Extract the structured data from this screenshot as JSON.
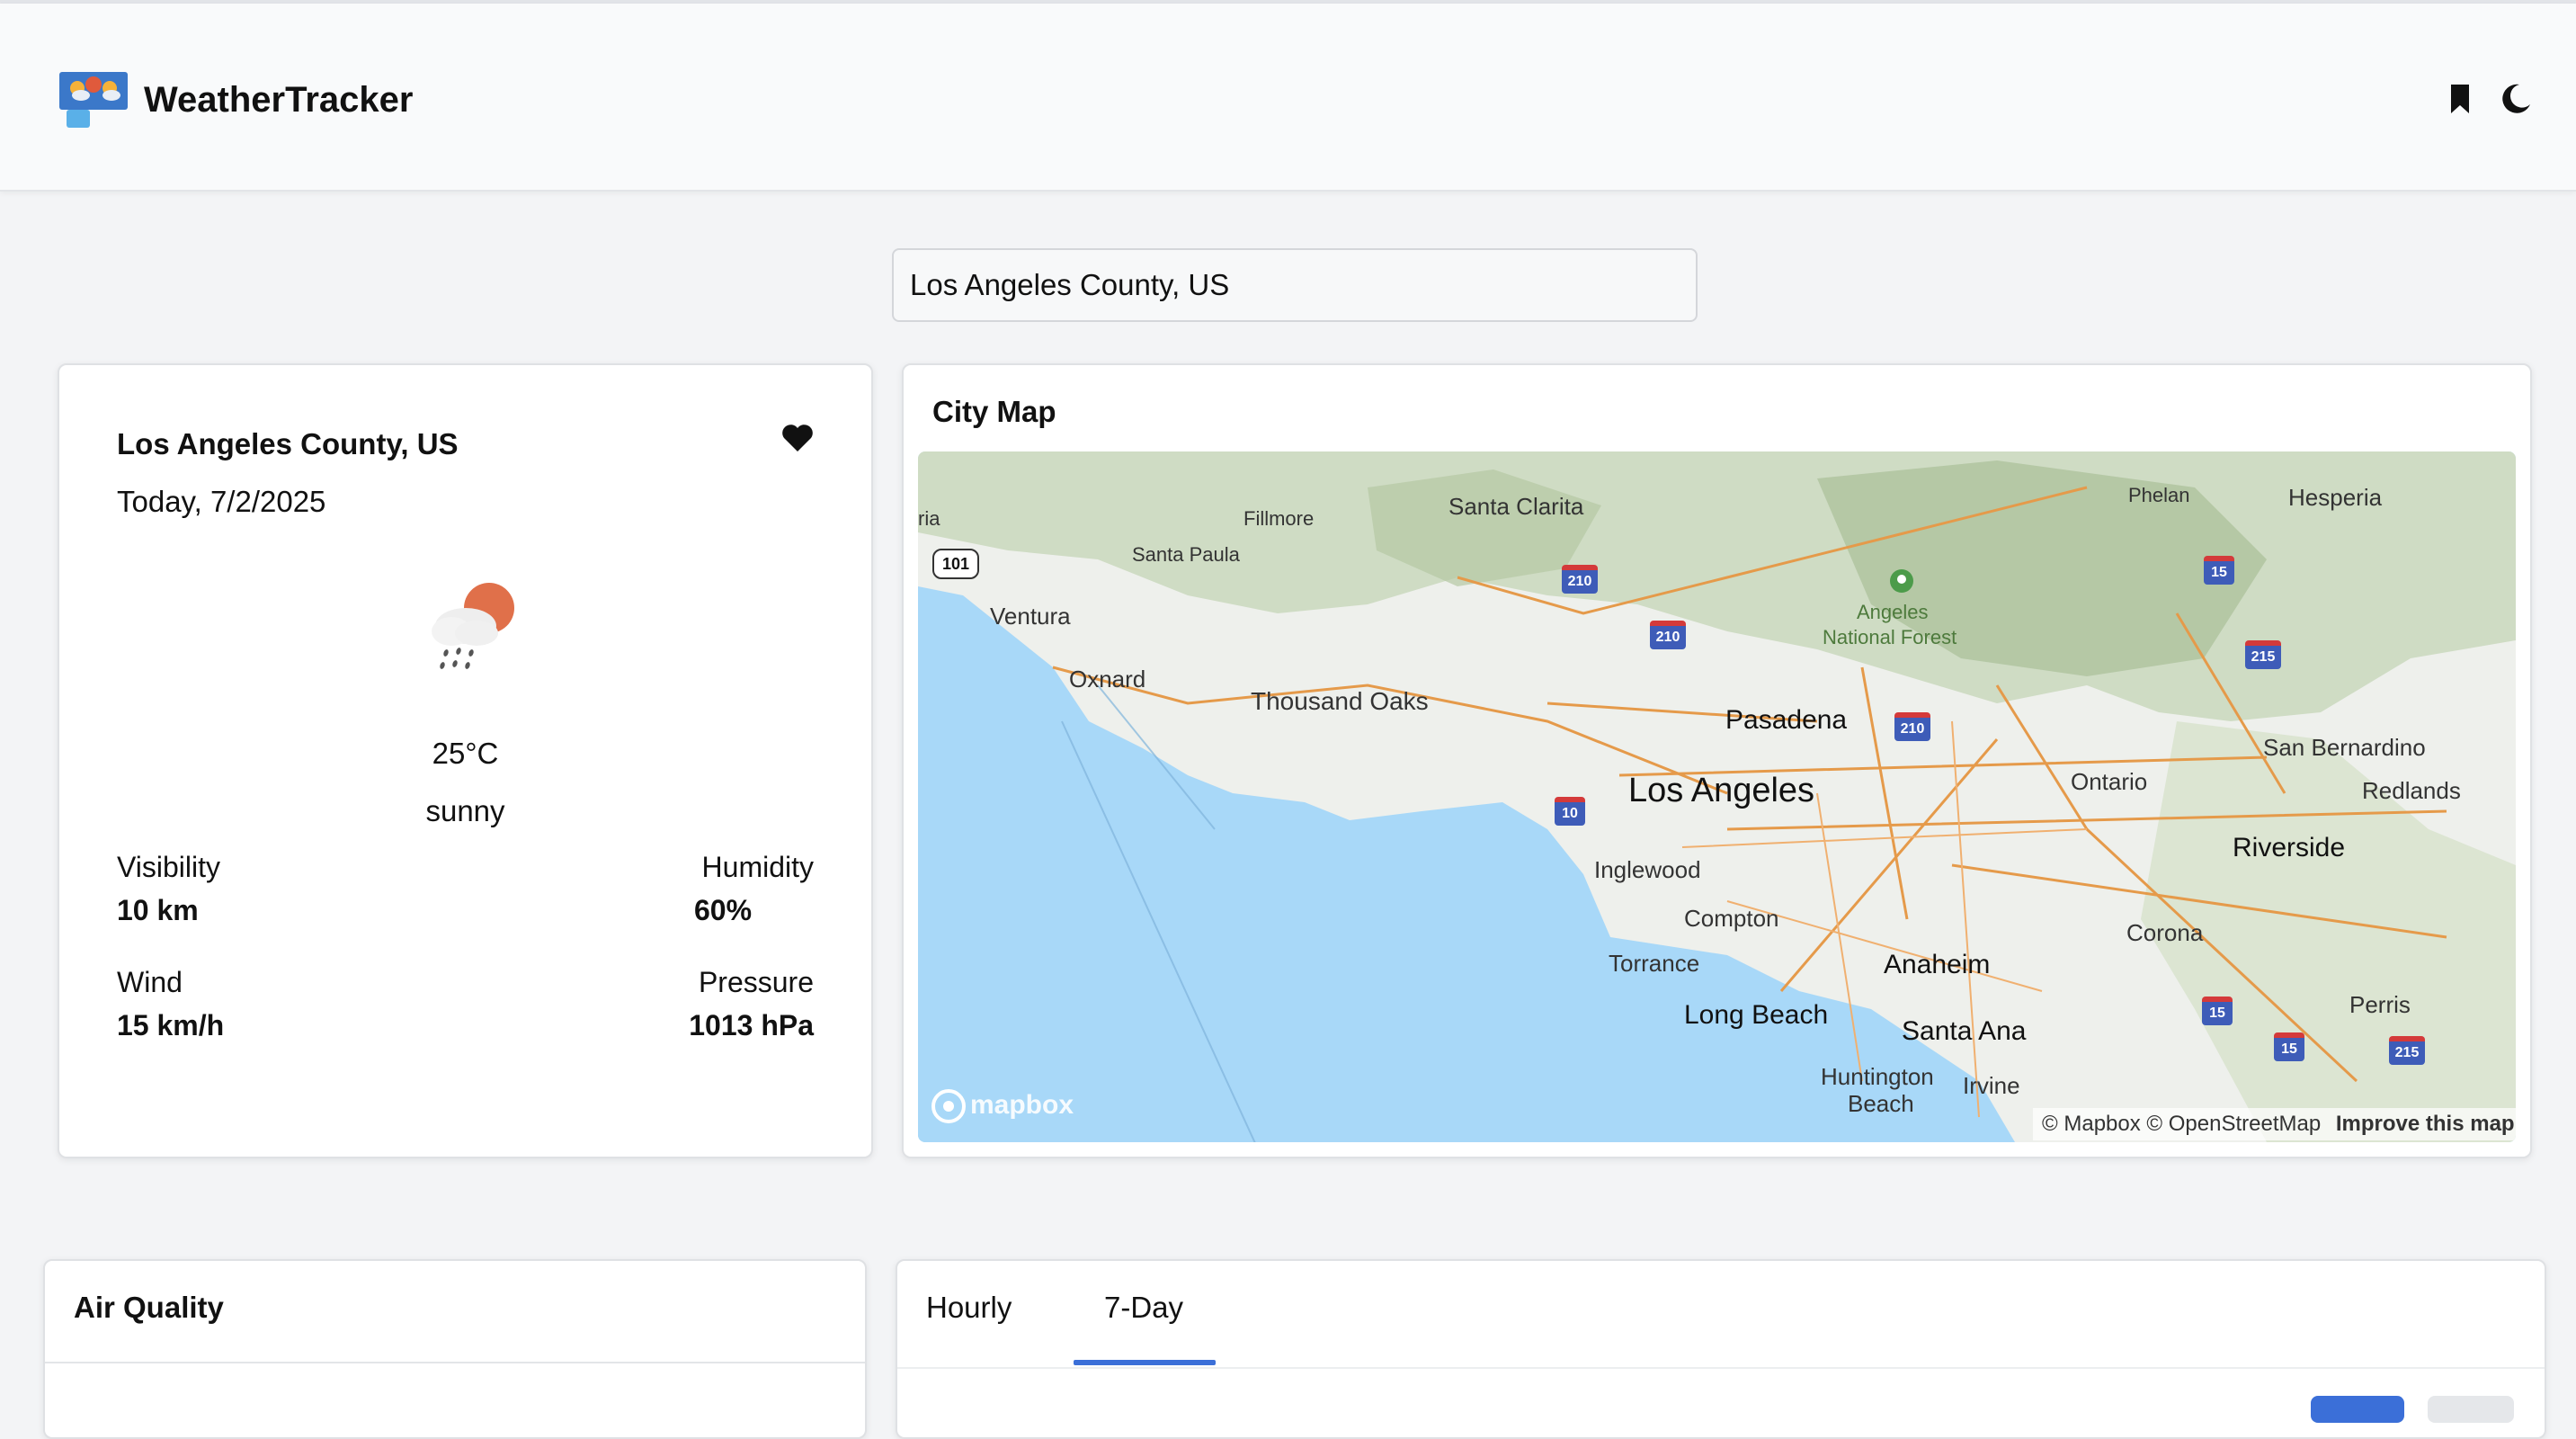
{
  "app": {
    "title": "WeatherTracker",
    "icons": {
      "logo": "weather-logo-icon",
      "bookmark": "bookmark-icon",
      "theme": "moon-icon"
    }
  },
  "search": {
    "value": "Los Angeles County, US"
  },
  "weather": {
    "location": "Los Angeles County, US",
    "date": "Today, 7/2/2025",
    "temperature": "25°C",
    "condition": "sunny",
    "condition_icon": "sun-cloud-rain-icon",
    "favorite_icon": "heart-icon",
    "details": [
      {
        "label": "Visibility",
        "value": "10 km"
      },
      {
        "label": "Humidity",
        "value": "60%"
      },
      {
        "label": "Wind",
        "value": "15 km/h"
      },
      {
        "label": "Pressure",
        "value": "1013 hPa"
      }
    ]
  },
  "map": {
    "title": "City Map",
    "labels": {
      "santa_clarita": "Santa Clarita",
      "fillmore": "Fillmore",
      "santa_paula": "Santa Paula",
      "ventura": "Ventura",
      "oxnard": "Oxnard",
      "thousand_oaks": "Thousand Oaks",
      "pasadena": "Pasadena",
      "los_angeles": "Los Angeles",
      "inglewood": "Inglewood",
      "compton": "Compton",
      "torrance": "Torrance",
      "long_beach": "Long Beach",
      "anaheim": "Anaheim",
      "santa_ana": "Santa Ana",
      "huntington": "Huntington",
      "beach": "Beach",
      "irvine": "Irvine",
      "corona": "Corona",
      "ontario": "Ontario",
      "riverside": "Riverside",
      "redlands": "Redlands",
      "san_bernardino": "San Bernardino",
      "perris": "Perris",
      "phelan": "Phelan",
      "hesperia": "Hesperia",
      "angeles": "Angeles",
      "national_forest": "National Forest",
      "ria": "ria"
    },
    "shields": {
      "s101": "101",
      "s210a": "210",
      "s210b": "210",
      "s210c": "210",
      "s10": "10",
      "s15a": "15",
      "s215a": "215",
      "s15b": "15",
      "s15c": "15",
      "s215b": "215"
    },
    "attribution": "© Mapbox © OpenStreetMap",
    "improve": "Improve this map",
    "brand": "mapbox"
  },
  "air_quality": {
    "title": "Air Quality"
  },
  "forecast": {
    "tabs": [
      "Hourly",
      "7-Day"
    ],
    "active_tab": "7-Day"
  }
}
